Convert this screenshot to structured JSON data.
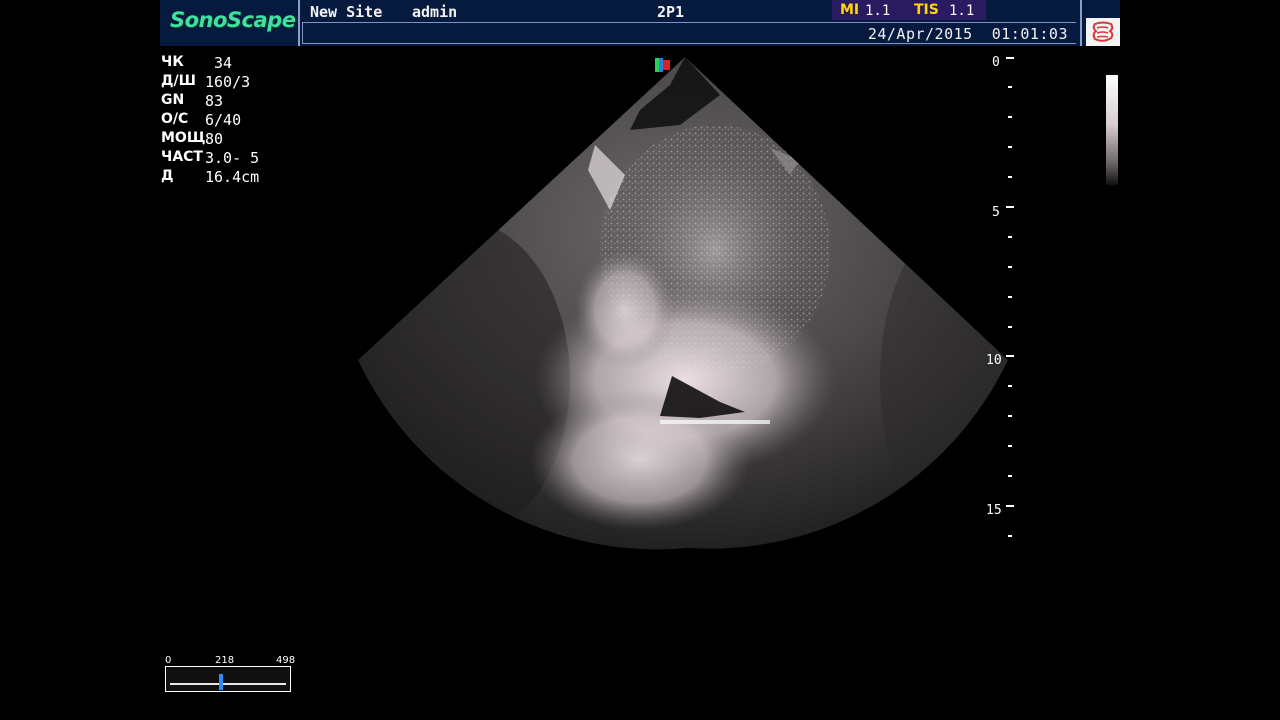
{
  "header": {
    "brand": "SonoScape",
    "site_name": "New Site",
    "user_name": "admin",
    "probe_id": "2P1",
    "indices": {
      "mi_label": "MI",
      "mi_value": "1.1",
      "tis_label": "TIS",
      "tis_value": "1.1",
      "label_color": "#ffd800"
    },
    "datetime": "24/Apr/2015  01:01:03",
    "organ_icon": "abdomen-organ-icon"
  },
  "params": [
    {
      "label": "ЧК",
      "value": " 34"
    },
    {
      "label": "Д/Ш",
      "value": "160/3"
    },
    {
      "label": "GN",
      "value": "83"
    },
    {
      "label": "О/С",
      "value": "6/40"
    },
    {
      "label": "МОЩ",
      "value": "80"
    },
    {
      "label": "ЧАСТ",
      "value": "3.0- 5"
    },
    {
      "label": "Д",
      "value": "16.4cm"
    }
  ],
  "depth_scale": {
    "labels": [
      "0",
      "5",
      "10",
      "15"
    ],
    "unit_step": 5
  },
  "cine": {
    "min": "0",
    "current": "218",
    "max": "498",
    "position_fraction": 0.438
  },
  "colors": {
    "header_bg": "#061a3f",
    "brand": "#3fe0a0",
    "indices_bg": "#2a1a60",
    "cine_slider": "#2a8cff"
  }
}
